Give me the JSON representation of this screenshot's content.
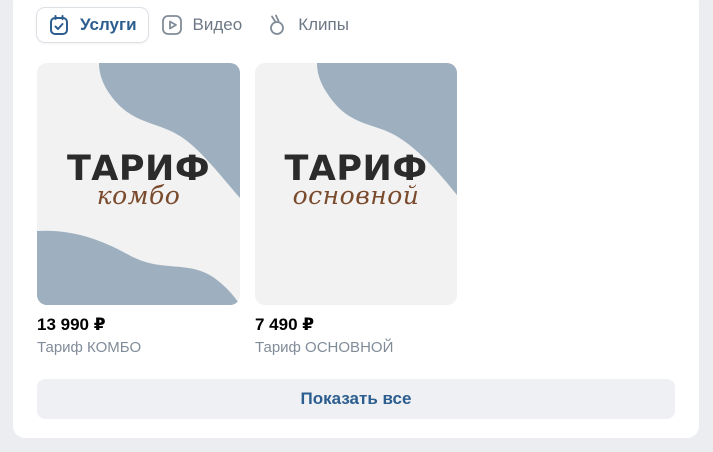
{
  "tabs": [
    {
      "label": "Услуги",
      "icon": "services-icon",
      "active": true
    },
    {
      "label": "Видео",
      "icon": "video-icon",
      "active": false
    },
    {
      "label": "Клипы",
      "icon": "clips-icon",
      "active": false
    }
  ],
  "items": [
    {
      "thumb_title": "ТАРИФ",
      "thumb_subtitle": "комбо",
      "price": "13 990 ₽",
      "name": "Тариф КОМБО"
    },
    {
      "thumb_title": "ТАРИФ",
      "thumb_subtitle": "основной",
      "price": "7 490 ₽",
      "name": "Тариф ОСНОВНОЙ"
    }
  ],
  "show_all_label": "Показать все",
  "colors": {
    "accent": "#2c5d8f",
    "secondary": "#818c99",
    "blob": "#9eb0bf",
    "thumb_bg": "#f2f2f2"
  }
}
